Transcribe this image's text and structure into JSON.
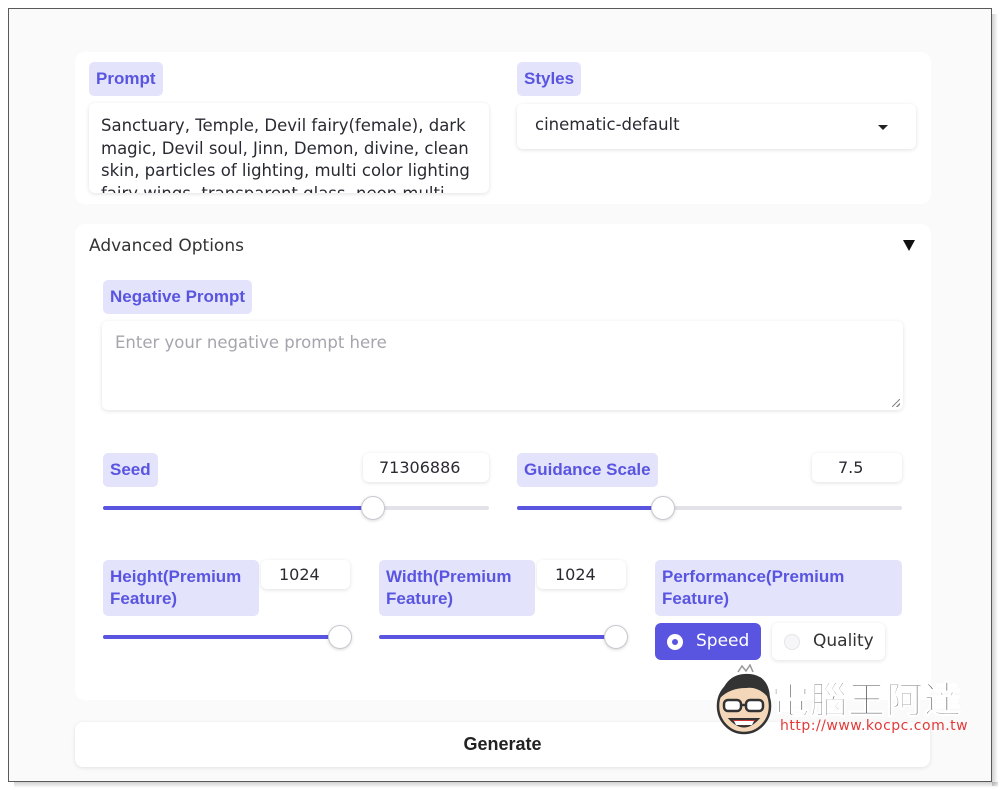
{
  "prompt": {
    "label": "Prompt",
    "value": "Sanctuary, Temple, Devil fairy(female), dark magic, Devil soul, Jinn, Demon, divine, clean skin, particles of lighting, multi color lighting fairy wings, transparent glass, neon multi"
  },
  "styles": {
    "label": "Styles",
    "selected": "cinematic-default"
  },
  "advanced": {
    "label": "Advanced Options",
    "negative_prompt": {
      "label": "Negative Prompt",
      "placeholder": "Enter your negative prompt here"
    },
    "seed": {
      "label": "Seed",
      "value": "71306886",
      "slider_fraction": 0.7
    },
    "guidance": {
      "label": "Guidance Scale",
      "value": "7.5",
      "slider_fraction": 0.38
    },
    "height": {
      "label_line1": "Height(Premium",
      "label_line2": "Feature)",
      "value": "1024",
      "slider_fraction": 1.0
    },
    "width": {
      "label_line1": "Width(Premium",
      "label_line2": "Feature)",
      "value": "1024",
      "slider_fraction": 1.0
    },
    "performance": {
      "label_line1": "Performance(Premium",
      "label_line2": "Feature)",
      "options": [
        "Speed",
        "Quality"
      ],
      "selected": "Speed"
    }
  },
  "generate_label": "Generate",
  "watermark": {
    "brand": "電腦王阿達",
    "url": "http://www.kocpc.com.tw"
  },
  "colors": {
    "accent": "#5a55e0",
    "chip_bg": "#e3e4fb"
  }
}
